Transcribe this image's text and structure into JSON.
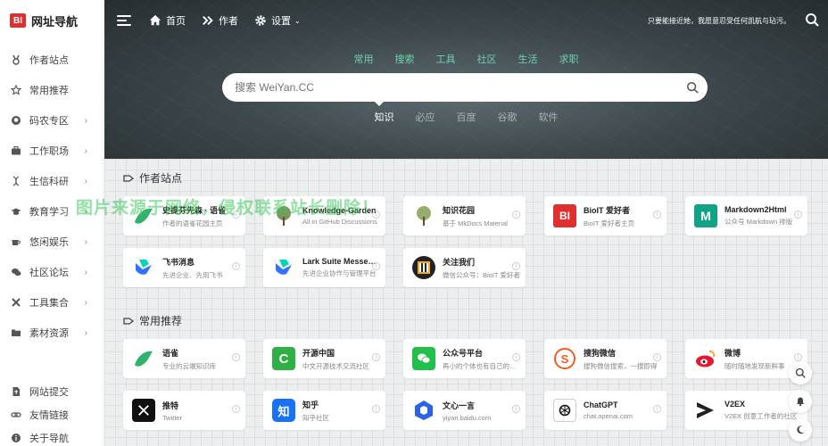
{
  "logo": {
    "badge": "BI",
    "title": "网址导航"
  },
  "sidebar": {
    "items": [
      {
        "label": "作者站点",
        "icon": "medal-icon",
        "chevron": false
      },
      {
        "label": "常用推荐",
        "icon": "star-icon",
        "chevron": false
      },
      {
        "label": "码农专区",
        "icon": "github-icon",
        "chevron": true
      },
      {
        "label": "工作职场",
        "icon": "briefcase-icon",
        "chevron": true
      },
      {
        "label": "生信科研",
        "icon": "dna-icon",
        "chevron": true
      },
      {
        "label": "教育学习",
        "icon": "graduation-cap-icon",
        "chevron": true
      },
      {
        "label": "悠闲娱乐",
        "icon": "coffee-icon",
        "chevron": true
      },
      {
        "label": "社区论坛",
        "icon": "chat-icon",
        "chevron": true
      },
      {
        "label": "工具集合",
        "icon": "tools-icon",
        "chevron": true
      },
      {
        "label": "素材资源",
        "icon": "folder-icon",
        "chevron": true
      }
    ],
    "bottom": [
      {
        "label": "网站提交",
        "icon": "file-upload-icon"
      },
      {
        "label": "友情链接",
        "icon": "link-icon"
      },
      {
        "label": "关于导航",
        "icon": "info-icon"
      }
    ]
  },
  "topbar": {
    "home": "首页",
    "author": "作者",
    "settings": "设置",
    "motto": "只要能接近她，我愿意忍受任何凯航与玷污。"
  },
  "search": {
    "categories": [
      "常用",
      "搜索",
      "工具",
      "社区",
      "生活",
      "求职"
    ],
    "placeholder": "搜索 WeiYan.CC",
    "engines": [
      "知识",
      "必应",
      "百度",
      "谷歌",
      "软件"
    ],
    "active_engine": "知识"
  },
  "watermark": "图片来源于网络，侵权联系站长删除！",
  "sections": [
    {
      "title": "作者站点",
      "cards": [
        {
          "title": "史提芬先森 · 语雀",
          "desc": "作者的语雀花园主页",
          "icon": "yuque-bird-icon",
          "color": "#2fb36a"
        },
        {
          "title": "Knowledge-Garden",
          "desc": "All in GitHub Discussions",
          "icon": "tree-icon",
          "color": "#5b7a3a"
        },
        {
          "title": "知识花园",
          "desc": "基于 MkDocs Material",
          "icon": "tree-icon",
          "color": "#7a9a4a"
        },
        {
          "title": "BioIT 爱好者",
          "desc": "BioIT 爱好者主页",
          "icon": "bi-logo-icon",
          "color": "#e02f2f"
        },
        {
          "title": "Markdown2Html",
          "desc": "公众号 Markdown 排版",
          "icon": "m-logo-icon",
          "color": "#11a385"
        },
        {
          "title": "飞书消息",
          "desc": "先进企业、先用飞书",
          "icon": "feishu-icon",
          "color": "#3370ff"
        },
        {
          "title": "Lark Suite Messenger",
          "desc": "先进企业协作与管理平台",
          "icon": "feishu-icon",
          "color": "#3370ff"
        },
        {
          "title": "关注我们",
          "desc": "微信公众号：BioIT 爱好者",
          "icon": "qrcode-icon",
          "color": "#222222"
        }
      ]
    },
    {
      "title": "常用推荐",
      "cards": [
        {
          "title": "语雀",
          "desc": "专业的云端知识库",
          "icon": "yuque-bird-icon",
          "color": "#2fb36a"
        },
        {
          "title": "开源中国",
          "desc": "中文开源技术交流社区",
          "icon": "oschina-icon",
          "color": "#2eb047"
        },
        {
          "title": "公众号平台",
          "desc": "再小的个体也有自己的品牌",
          "icon": "wechat-icon",
          "color": "#22c04b"
        },
        {
          "title": "搜狗微信",
          "desc": "搜狗微信搜索，一搜即得",
          "icon": "sogou-icon",
          "color": "#f35c20"
        },
        {
          "title": "微博",
          "desc": "随时随地发现新鲜事",
          "icon": "weibo-icon",
          "color": "#e6162d"
        },
        {
          "title": "推特",
          "desc": "Twitter",
          "icon": "x-logo-icon",
          "color": "#111111"
        },
        {
          "title": "知乎",
          "desc": "知乎社区",
          "icon": "zhihu-icon",
          "color": "#1772f6"
        },
        {
          "title": "文心一言",
          "desc": "yiyan.baidu.com",
          "icon": "wenxin-icon",
          "color": "#2c62e8"
        },
        {
          "title": "ChatGPT",
          "desc": "chat.openai.com",
          "icon": "openai-icon",
          "color": "#111111"
        },
        {
          "title": "V2EX",
          "desc": "V2EX 创意工作者的社区",
          "icon": "v2ex-icon",
          "color": "#222222"
        }
      ]
    }
  ]
}
